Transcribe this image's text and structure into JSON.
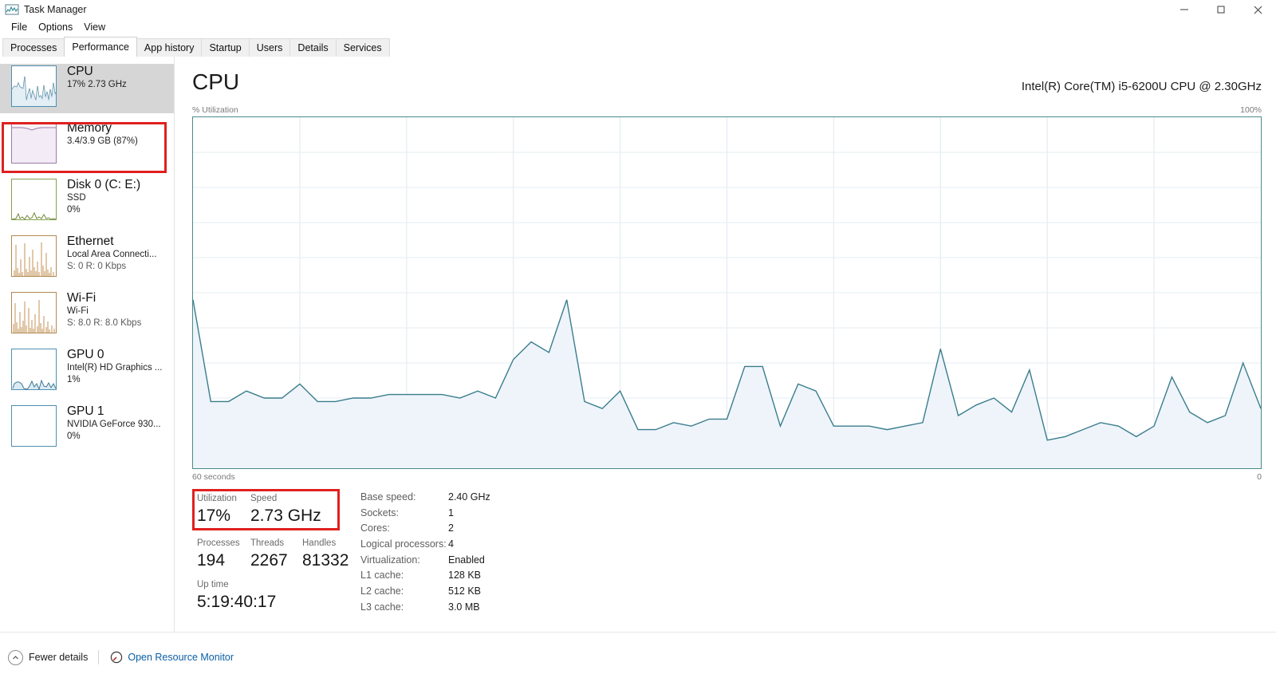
{
  "window": {
    "title": "Task Manager",
    "icon": "task-manager-icon",
    "controls": {
      "minimize": "Minimize",
      "maximize": "Maximize",
      "close": "Close"
    }
  },
  "menu": {
    "items": [
      "File",
      "Options",
      "View"
    ]
  },
  "tabs": {
    "items": [
      "Processes",
      "Performance",
      "App history",
      "Startup",
      "Users",
      "Details",
      "Services"
    ],
    "active": "Performance"
  },
  "sidebar": {
    "items": [
      {
        "name": "CPU",
        "sub1": "17%  2.73 GHz",
        "sub2": "",
        "selected": true,
        "graph": "cpu-thumb",
        "stroke": "#3e7a95",
        "fill": "#dceaf2",
        "border": "#4e8fb0"
      },
      {
        "name": "Memory",
        "sub1": "3.4/3.9 GB (87%)",
        "sub2": "",
        "selected": false,
        "graph": "memory-thumb",
        "stroke": "#9b7ca8",
        "fill": "#f3ebf6",
        "border": "#9b7ca8"
      },
      {
        "name": "Disk 0 (C: E:)",
        "sub1": "SSD",
        "sub2": "0%",
        "selected": false,
        "graph": "disk-thumb",
        "stroke": "#6f8a3a",
        "fill": "#f2f6e8",
        "border": "#86a04f"
      },
      {
        "name": "Ethernet",
        "sub1": "Local Area Connecti...",
        "sub2": "S: 0 R: 0 Kbps",
        "selected": false,
        "graph": "ethernet-thumb",
        "stroke": "#b5793a",
        "fill": "#f6ecdf",
        "border": "#b08a52"
      },
      {
        "name": "Wi-Fi",
        "sub1": "Wi-Fi",
        "sub2": "S: 8.0 R: 8.0 Kbps",
        "selected": false,
        "graph": "wifi-thumb",
        "stroke": "#b5793a",
        "fill": "#f6ecdf",
        "border": "#b08a52"
      },
      {
        "name": "GPU 0",
        "sub1": "Intel(R) HD Graphics ...",
        "sub2": "1%",
        "selected": false,
        "graph": "gpu0-thumb",
        "stroke": "#3e7a95",
        "fill": "#dceaf2",
        "border": "#4e8fb0"
      },
      {
        "name": "GPU 1",
        "sub1": "NVIDIA GeForce 930...",
        "sub2": "0%",
        "selected": false,
        "graph": "gpu1-thumb",
        "stroke": "#3e7a95",
        "fill": "#eef5f9",
        "border": "#4e8fb0"
      }
    ]
  },
  "main": {
    "title": "CPU",
    "cpu_name": "Intel(R) Core(TM) i5-6200U CPU @ 2.30GHz",
    "axis_top_left": "% Utilization",
    "axis_top_right": "100%",
    "axis_bottom_left": "60 seconds",
    "axis_bottom_right": "0"
  },
  "stats": {
    "utilization": {
      "label": "Utilization",
      "value": "17%"
    },
    "speed": {
      "label": "Speed",
      "value": "2.73 GHz"
    },
    "processes": {
      "label": "Processes",
      "value": "194"
    },
    "threads": {
      "label": "Threads",
      "value": "2267"
    },
    "handles": {
      "label": "Handles",
      "value": "81332"
    },
    "uptime": {
      "label": "Up time",
      "value": "5:19:40:17"
    },
    "details": [
      {
        "key": "Base speed:",
        "value": "2.40 GHz"
      },
      {
        "key": "Sockets:",
        "value": "1"
      },
      {
        "key": "Cores:",
        "value": "2"
      },
      {
        "key": "Logical processors:",
        "value": "4"
      },
      {
        "key": "Virtualization:",
        "value": "Enabled"
      },
      {
        "key": "L1 cache:",
        "value": "128 KB"
      },
      {
        "key": "L2 cache:",
        "value": "512 KB"
      },
      {
        "key": "L3 cache:",
        "value": "3.0 MB"
      }
    ]
  },
  "statusbar": {
    "fewer_details": "Fewer details",
    "fewer_details_icon": "chevron-up-icon",
    "resource_monitor": "Open Resource Monitor",
    "resource_monitor_icon": "resource-monitor-icon"
  },
  "highlights": {
    "color": "#e02020",
    "boxes": [
      "sidebar-cpu-item",
      "utilization-speed-stats"
    ]
  },
  "chart_data": {
    "type": "area",
    "title": "CPU % Utilization",
    "xlabel": "60 seconds",
    "ylabel": "% Utilization",
    "ylim": [
      0,
      100
    ],
    "xlim": [
      0,
      60
    ],
    "grid": true,
    "grid_cols": 10,
    "grid_rows": 10,
    "legend": "none",
    "line_color": "#3a7d8c",
    "fill_color": "#eef4fa",
    "axis_labels": {
      "top_left": "% Utilization",
      "top_right": "100%",
      "bottom_left": "60 seconds",
      "bottom_right": "0"
    },
    "x": [
      0,
      1,
      2,
      3,
      4,
      5,
      6,
      7,
      8,
      9,
      10,
      11,
      12,
      13,
      14,
      15,
      16,
      17,
      18,
      19,
      20,
      21,
      22,
      23,
      24,
      25,
      26,
      27,
      28,
      29,
      30,
      31,
      32,
      33,
      34,
      35,
      36,
      37,
      38,
      39,
      40,
      41,
      42,
      43,
      44,
      45,
      46,
      47,
      48,
      49,
      50,
      51,
      52,
      53,
      54,
      55,
      56,
      57,
      58,
      59,
      60
    ],
    "values": [
      48,
      19,
      19,
      22,
      20,
      20,
      24,
      19,
      19,
      20,
      20,
      21,
      21,
      21,
      21,
      20,
      22,
      20,
      31,
      36,
      33,
      48,
      19,
      17,
      22,
      11,
      11,
      13,
      12,
      14,
      14,
      29,
      29,
      12,
      24,
      22,
      12,
      12,
      12,
      11,
      12,
      13,
      34,
      15,
      18,
      20,
      16,
      28,
      8,
      9,
      11,
      13,
      12,
      9,
      12,
      26,
      16,
      13,
      15,
      30,
      17
    ]
  }
}
